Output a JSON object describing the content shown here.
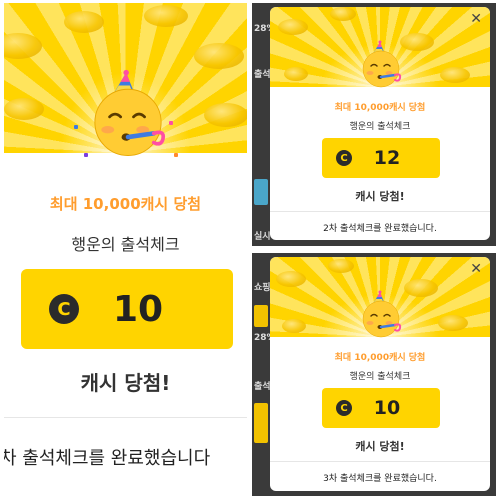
{
  "popup_large": {
    "title": "최대 10,000캐시 당첨",
    "subtitle": "행운의 출석체크",
    "cash_icon": "C",
    "amount": "10",
    "result": "캐시 당첨!",
    "completion": "차 출석체크를 완료했습니다"
  },
  "popup_top": {
    "title": "최대 10,000캐시 당첨",
    "subtitle": "행운의 출석체크",
    "cash_icon": "C",
    "amount": "12",
    "result": "캐시 당첨!",
    "completion": "2차 출석체크를 완료했습니다.",
    "close_label": "✕"
  },
  "popup_bottom": {
    "title": "최대 10,000캐시 당첨",
    "subtitle": "행운의 출석체크",
    "cash_icon": "C",
    "amount": "10",
    "result": "캐시 당첨!",
    "completion": "3차 출석체크를 완료했습니다.",
    "close_label": "✕"
  },
  "background_fragments": {
    "top_left": "28%",
    "top_label": "출석",
    "top_mid": "실시",
    "bottom_left": "쇼핑",
    "bottom_pct": "28%",
    "bottom_label": "출석"
  },
  "icons": {
    "emoji": "partying-face-icon",
    "cash": "cash-coin-icon",
    "close": "close-icon"
  },
  "colors": {
    "brand_yellow": "#ffd400",
    "title_orange": "#ff9d2e",
    "dark": "#222222"
  }
}
